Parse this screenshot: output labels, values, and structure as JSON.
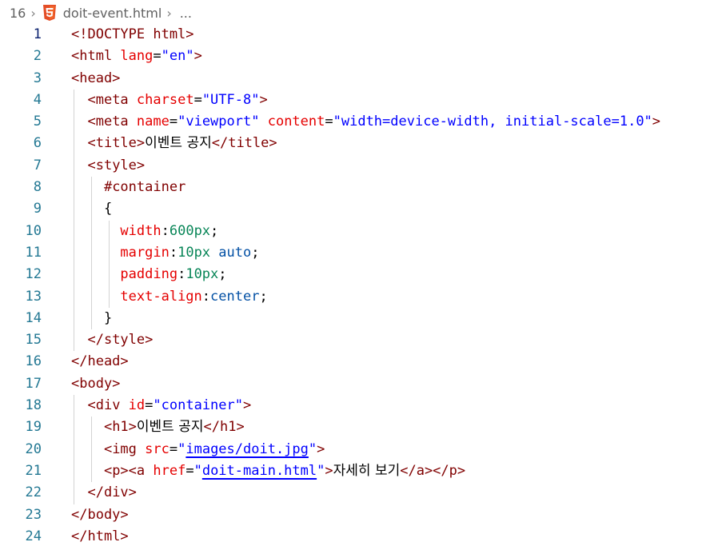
{
  "breadcrumb": {
    "column": "16",
    "file": "doit-event.html",
    "more": "..."
  },
  "lines": [
    {
      "n": "1",
      "tokens": [
        [
          "tag",
          "<!DOCTYPE html>"
        ]
      ]
    },
    {
      "n": "2",
      "tokens": [
        [
          "tag",
          "<html "
        ],
        [
          "attr",
          "lang"
        ],
        [
          "txt",
          "="
        ],
        [
          "val",
          "\"en\""
        ],
        [
          "tag",
          ">"
        ]
      ]
    },
    {
      "n": "3",
      "tokens": [
        [
          "tag",
          "<head>"
        ]
      ]
    },
    {
      "n": "4",
      "tokens": [
        [
          "txt",
          "  "
        ],
        [
          "tag",
          "<meta "
        ],
        [
          "attr",
          "charset"
        ],
        [
          "txt",
          "="
        ],
        [
          "val",
          "\"UTF-8\""
        ],
        [
          "tag",
          ">"
        ]
      ]
    },
    {
      "n": "5",
      "tokens": [
        [
          "txt",
          "  "
        ],
        [
          "tag",
          "<meta "
        ],
        [
          "attr",
          "name"
        ],
        [
          "txt",
          "="
        ],
        [
          "val",
          "\"viewport\""
        ],
        [
          "txt",
          " "
        ],
        [
          "attr",
          "content"
        ],
        [
          "txt",
          "="
        ],
        [
          "val",
          "\"width=device-width, initial-scale=1.0\""
        ],
        [
          "tag",
          ">"
        ]
      ]
    },
    {
      "n": "6",
      "tokens": [
        [
          "txt",
          "  "
        ],
        [
          "tag",
          "<title>"
        ],
        [
          "kr",
          "이벤트 공지"
        ],
        [
          "tag",
          "</title>"
        ]
      ]
    },
    {
      "n": "7",
      "tokens": [
        [
          "txt",
          "  "
        ],
        [
          "tag",
          "<style>"
        ]
      ]
    },
    {
      "n": "8",
      "tokens": [
        [
          "txt",
          "    "
        ],
        [
          "sel",
          "#container"
        ]
      ]
    },
    {
      "n": "9",
      "tokens": [
        [
          "txt",
          "    {"
        ]
      ]
    },
    {
      "n": "10",
      "tokens": [
        [
          "txt",
          "      "
        ],
        [
          "prop",
          "width"
        ],
        [
          "txt",
          ":"
        ],
        [
          "cnum",
          "600px"
        ],
        [
          "txt",
          ";"
        ]
      ]
    },
    {
      "n": "11",
      "tokens": [
        [
          "txt",
          "      "
        ],
        [
          "prop",
          "margin"
        ],
        [
          "txt",
          ":"
        ],
        [
          "cnum",
          "10px"
        ],
        [
          "txt",
          " "
        ],
        [
          "cval",
          "auto"
        ],
        [
          "txt",
          ";"
        ]
      ]
    },
    {
      "n": "12",
      "tokens": [
        [
          "txt",
          "      "
        ],
        [
          "prop",
          "padding"
        ],
        [
          "txt",
          ":"
        ],
        [
          "cnum",
          "10px"
        ],
        [
          "txt",
          ";"
        ]
      ]
    },
    {
      "n": "13",
      "tokens": [
        [
          "txt",
          "      "
        ],
        [
          "prop",
          "text-align"
        ],
        [
          "txt",
          ":"
        ],
        [
          "cval",
          "center"
        ],
        [
          "txt",
          ";"
        ]
      ]
    },
    {
      "n": "14",
      "tokens": [
        [
          "txt",
          "    }"
        ]
      ]
    },
    {
      "n": "15",
      "tokens": [
        [
          "txt",
          "  "
        ],
        [
          "tag",
          "</style>"
        ]
      ]
    },
    {
      "n": "16",
      "tokens": [
        [
          "tag",
          "</head>"
        ]
      ]
    },
    {
      "n": "17",
      "tokens": [
        [
          "tag",
          "<body>"
        ]
      ]
    },
    {
      "n": "18",
      "tokens": [
        [
          "txt",
          "  "
        ],
        [
          "tag",
          "<div "
        ],
        [
          "attr",
          "id"
        ],
        [
          "txt",
          "="
        ],
        [
          "val",
          "\"container\""
        ],
        [
          "tag",
          ">"
        ]
      ]
    },
    {
      "n": "19",
      "tokens": [
        [
          "txt",
          "    "
        ],
        [
          "tag",
          "<h1>"
        ],
        [
          "kr",
          "이벤트 공지"
        ],
        [
          "tag",
          "</h1>"
        ]
      ]
    },
    {
      "n": "20",
      "tokens": [
        [
          "txt",
          "    "
        ],
        [
          "tag",
          "<img "
        ],
        [
          "attr",
          "src"
        ],
        [
          "txt",
          "="
        ],
        [
          "val",
          "\""
        ],
        [
          "link",
          "images/doit.jpg"
        ],
        [
          "val",
          "\""
        ],
        [
          "tag",
          ">"
        ]
      ]
    },
    {
      "n": "21",
      "tokens": [
        [
          "txt",
          "    "
        ],
        [
          "tag",
          "<p><a "
        ],
        [
          "attr",
          "href"
        ],
        [
          "txt",
          "="
        ],
        [
          "val",
          "\""
        ],
        [
          "link",
          "doit-main.html"
        ],
        [
          "val",
          "\""
        ],
        [
          "tag",
          ">"
        ],
        [
          "kr",
          "자세히 보기"
        ],
        [
          "tag",
          "</a></p>"
        ]
      ]
    },
    {
      "n": "22",
      "tokens": [
        [
          "txt",
          "  "
        ],
        [
          "tag",
          "</div>"
        ]
      ]
    },
    {
      "n": "23",
      "tokens": [
        [
          "tag",
          "</body>"
        ]
      ]
    },
    {
      "n": "24",
      "tokens": [
        [
          "tag",
          "</html>"
        ]
      ]
    }
  ],
  "active_line": "1",
  "icons": {
    "file_type": "html5-icon",
    "separator": "chevron-right-icon"
  },
  "colors": {
    "tag": "#800000",
    "attribute": "#e50000",
    "string": "#0000ff",
    "css_number": "#098658",
    "css_value": "#0451a5",
    "line_number": "#237893",
    "active_line_number": "#0b216f"
  }
}
